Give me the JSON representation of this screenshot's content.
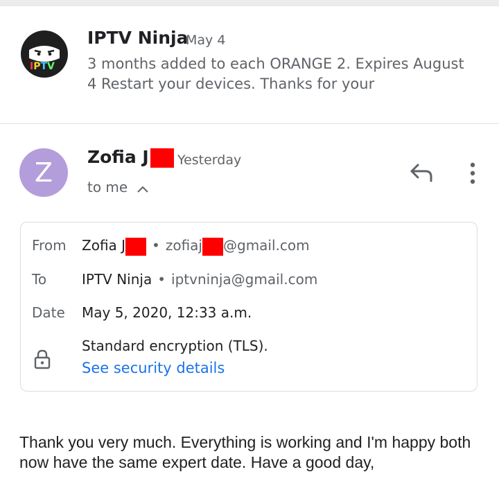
{
  "thread": {
    "message1": {
      "sender": "IPTV Ninja",
      "date": "May 4",
      "snippet": "3 months added to each ORANGE 2. Expires August 4 Restart your devices. Thanks for your",
      "avatar_text": "IPTV"
    },
    "message2": {
      "sender_visible": "Zofia J",
      "date": "Yesterday",
      "avatar_letter": "Z",
      "recipient_label": "to me",
      "details": {
        "from_label": "From",
        "from_name": "Zofia J",
        "from_email_prefix": "zofiaj",
        "from_email_suffix": "@gmail.com",
        "to_label": "To",
        "to_name": "IPTV Ninja",
        "to_email": "iptvninja@gmail.com",
        "date_label": "Date",
        "date_value": "May 5, 2020, 12:33 a.m.",
        "encryption": "Standard encryption (TLS).",
        "security_link": "See security details"
      },
      "body": "Thank you very much. Everything is working and I'm happy both now have the same expert date. Have a good day,"
    }
  },
  "icons": {
    "reply": "reply-arrow-icon",
    "more": "vertical-dots-icon",
    "lock": "lock-icon",
    "chevron": "chevron-up-icon"
  },
  "colors": {
    "avatar_z": "#b39ddb",
    "link": "#1a73e8",
    "redaction": "#ff0000"
  }
}
